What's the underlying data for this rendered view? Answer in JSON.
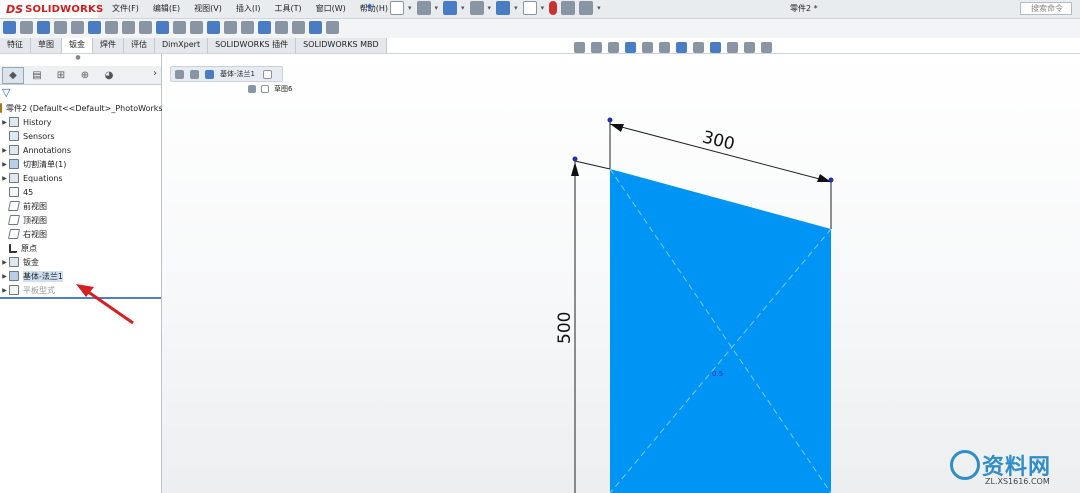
{
  "app": {
    "logo_ds": "DS",
    "logo_text": "SOLIDWORKS",
    "document_title": "零件2 *",
    "search_placeholder": "搜索命令"
  },
  "menu": [
    "文件(F)",
    "编辑(E)",
    "视图(V)",
    "插入(I)",
    "工具(T)",
    "窗口(W)",
    "帮助(H)"
  ],
  "tabs": [
    {
      "label": "特征",
      "active": false
    },
    {
      "label": "草图",
      "active": false
    },
    {
      "label": "钣金",
      "active": true
    },
    {
      "label": "焊件",
      "active": false
    },
    {
      "label": "评估",
      "active": false
    },
    {
      "label": "DimXpert",
      "active": false
    },
    {
      "label": "SOLIDWORKS 插件",
      "active": false
    },
    {
      "label": "SOLIDWORKS MBD",
      "active": false
    }
  ],
  "tree": {
    "root": "零件2  (Default<<Default>_PhotoWorks",
    "items": [
      {
        "label": "History",
        "expand": true,
        "icon": "history-icon"
      },
      {
        "label": "Sensors",
        "expand": false,
        "icon": "sensors-icon"
      },
      {
        "label": "Annotations",
        "expand": true,
        "icon": "annotations-icon"
      },
      {
        "label": "切割清单(1)",
        "expand": true,
        "icon": "cut-list-icon"
      },
      {
        "label": "Equations",
        "expand": true,
        "icon": "equations-icon"
      },
      {
        "label": "45",
        "expand": false,
        "icon": "material-icon"
      },
      {
        "label": "前视图",
        "expand": false,
        "icon": "plane-icon"
      },
      {
        "label": "顶视图",
        "expand": false,
        "icon": "plane-icon"
      },
      {
        "label": "右视图",
        "expand": false,
        "icon": "plane-icon"
      },
      {
        "label": "原点",
        "expand": false,
        "icon": "origin-icon"
      },
      {
        "label": "钣金",
        "expand": true,
        "icon": "sheet-metal-icon"
      },
      {
        "label": "基体-法兰1",
        "expand": true,
        "icon": "base-flange-icon",
        "selected": true
      },
      {
        "label": "平板型式",
        "expand": true,
        "icon": "flat-pattern-icon",
        "dim": true
      }
    ]
  },
  "breadcrumb": {
    "feature": "基体-法兰1",
    "sketch": "草图6"
  },
  "drawing": {
    "dim_width": "300",
    "dim_height": "500",
    "thickness_label": "0.5",
    "face_color": "#0094f4",
    "annotation_arrow_color": "#d42020"
  },
  "watermark": {
    "title": "资料网",
    "url": "ZL.XS1616.COM"
  }
}
